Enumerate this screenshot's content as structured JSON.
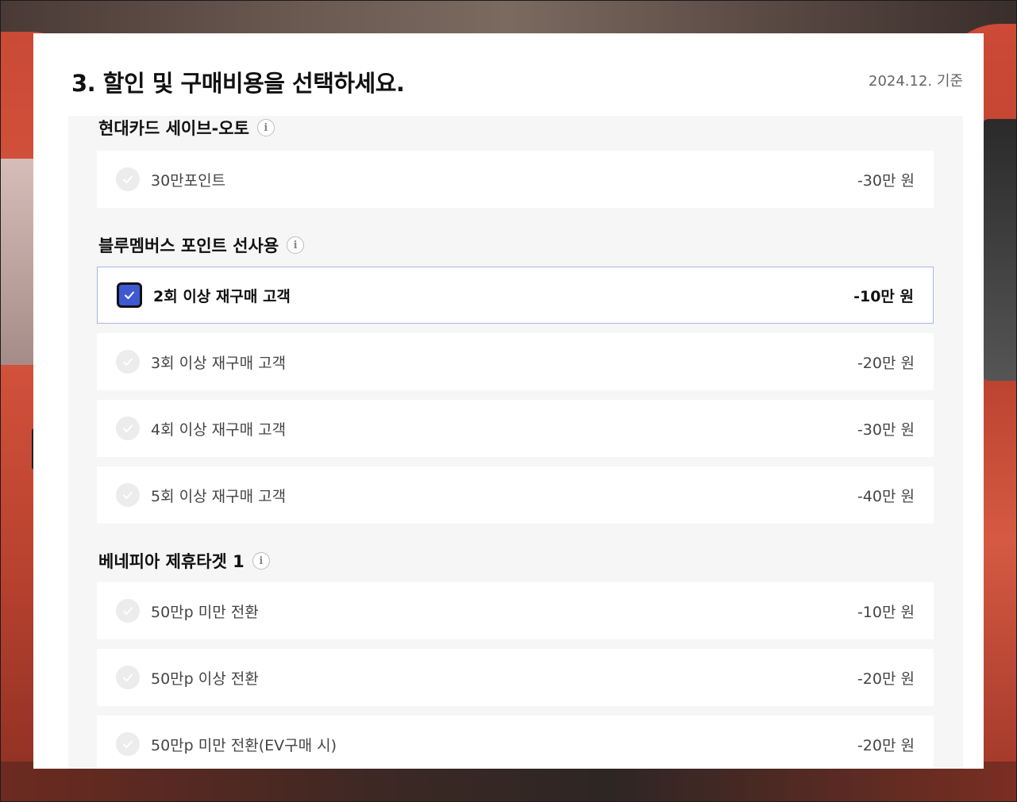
{
  "header": {
    "title": "3. 할인 및 구매비용을 선택하세요.",
    "date": "2024.12. 기준"
  },
  "groups": [
    {
      "title": "현대카드 세이브-오토",
      "info_icon": "info-icon",
      "options": [
        {
          "label": "30만포인트",
          "price": "-30만 원",
          "selected": false
        }
      ]
    },
    {
      "title": "블루멤버스 포인트 선사용",
      "info_icon": "info-icon",
      "options": [
        {
          "label": "2회 이상 재구매 고객",
          "price": "-10만 원",
          "selected": true
        },
        {
          "label": "3회 이상 재구매 고객",
          "price": "-20만 원",
          "selected": false
        },
        {
          "label": "4회 이상 재구매 고객",
          "price": "-30만 원",
          "selected": false
        },
        {
          "label": "5회 이상 재구매 고객",
          "price": "-40만 원",
          "selected": false
        }
      ]
    },
    {
      "title": "베네피아 제휴타겟 1",
      "info_icon": "info-icon",
      "options": [
        {
          "label": "50만p 미만 전환",
          "price": "-10만 원",
          "selected": false
        },
        {
          "label": "50만p 이상 전환",
          "price": "-20만 원",
          "selected": false
        },
        {
          "label": "50만p 미만 전환(EV구매 시)",
          "price": "-20만 원",
          "selected": false
        }
      ]
    }
  ],
  "colors": {
    "accent": "#3d5ad1",
    "selected_border": "#a9b6e4",
    "content_bg": "#f6f6f6"
  }
}
